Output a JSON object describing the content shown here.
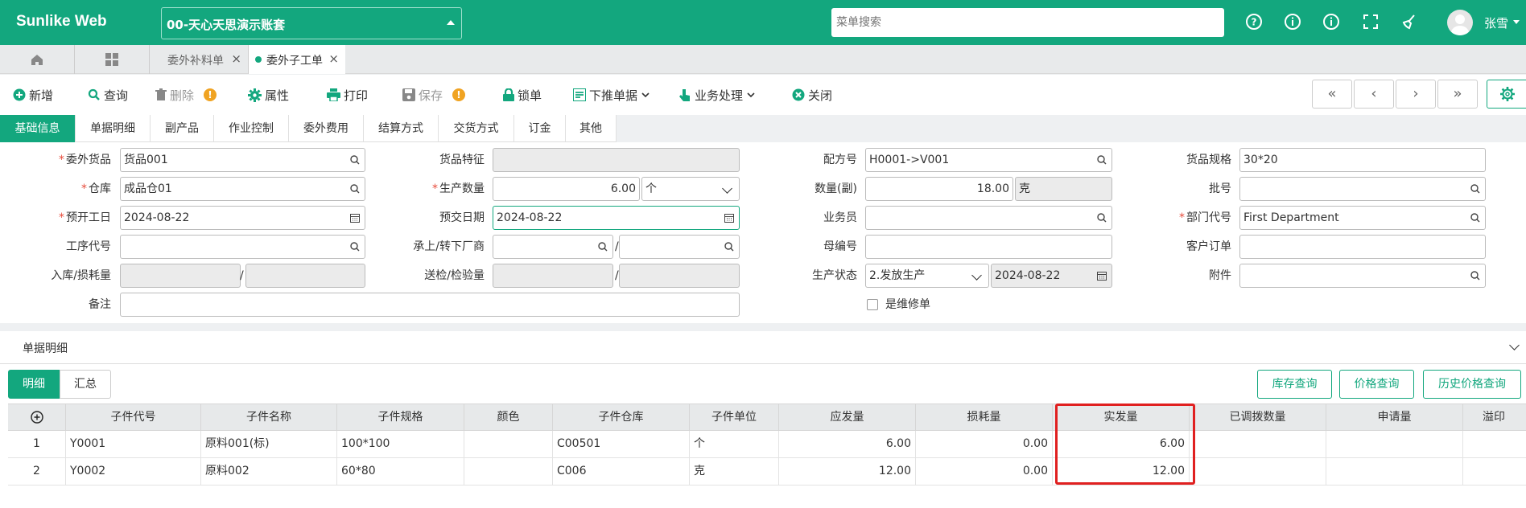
{
  "app": {
    "brand": "Sunlike Web",
    "account": "00-天心天思演示账套",
    "search_placeholder": "菜单搜索",
    "user": "张雪"
  },
  "tabs": [
    {
      "label": "委外补料单"
    },
    {
      "label": "委外子工单"
    }
  ],
  "toolbar": {
    "add": "新增",
    "query": "查询",
    "delete": "删除",
    "props": "属性",
    "print": "打印",
    "save": "保存",
    "lock": "锁单",
    "push": "下推单据",
    "business": "业务处理",
    "close": "关闭"
  },
  "nav": {
    "first": "«",
    "prev": "‹",
    "next": "›",
    "last": "»"
  },
  "form_tabs": [
    "基础信息",
    "单据明细",
    "副产品",
    "作业控制",
    "委外费用",
    "结算方式",
    "交货方式",
    "订金",
    "其他"
  ],
  "form": {
    "outsource_goods_label": "委外货品",
    "outsource_goods": "货品001",
    "goods_feature_label": "货品特征",
    "goods_feature": "",
    "formula_label": "配方号",
    "formula": "H0001->V001",
    "goods_spec_label": "货品规格",
    "goods_spec": "30*20",
    "warehouse_label": "仓库",
    "warehouse": "成品仓01",
    "prod_qty_label": "生产数量",
    "prod_qty": "6.00",
    "prod_unit": "个",
    "qty_sub_label": "数量(副)",
    "qty_sub": "18.00",
    "qty_sub_unit": "克",
    "batch_label": "批号",
    "batch": "",
    "start_date_label": "预开工日",
    "start_date": "2024-08-22",
    "due_date_label": "预交日期",
    "due_date": "2024-08-22",
    "salesman_label": "业务员",
    "salesman": "",
    "dept_label": "部门代号",
    "dept": "First Department",
    "process_label": "工序代号",
    "process": "",
    "vendor_label": "承上/转下厂商",
    "vendor_up": "",
    "vendor_down": "",
    "parent_label": "母编号",
    "parent": "",
    "cust_order_label": "客户订单",
    "cust_order": "",
    "stockin_label": "入库/损耗量",
    "stockin": "",
    "loss": "",
    "inspect_label": "送检/检验量",
    "inspect_send": "",
    "inspect_done": "",
    "prod_status_label": "生产状态",
    "prod_status": "2.发放生产",
    "prod_status_date": "2024-08-22",
    "attach_label": "附件",
    "attach": "",
    "remark_label": "备注",
    "remark": "",
    "repair_label": "是维修单",
    "slash": "/"
  },
  "detail": {
    "title": "单据明细",
    "subtabs": [
      "明细",
      "汇总"
    ],
    "buttons": [
      "库存查询",
      "价格查询",
      "历史价格查询"
    ],
    "columns": [
      "⊕",
      "子件代号",
      "子件名称",
      "子件规格",
      "颜色",
      "子件仓库",
      "子件单位",
      "应发量",
      "损耗量",
      "实发量",
      "已调拨数量",
      "申请量",
      "溢印"
    ],
    "rows": [
      [
        "1",
        "Y0001",
        "原料001(标)",
        "100*100",
        "",
        "C00501",
        "个",
        "6.00",
        "0.00",
        "6.00",
        "",
        "",
        ""
      ],
      [
        "2",
        "Y0002",
        "原料002",
        "60*80",
        "",
        "C006",
        "克",
        "12.00",
        "0.00",
        "12.00",
        "",
        "",
        ""
      ]
    ]
  },
  "colors": {
    "primary": "#13a77e",
    "highlight": "#e02020"
  }
}
